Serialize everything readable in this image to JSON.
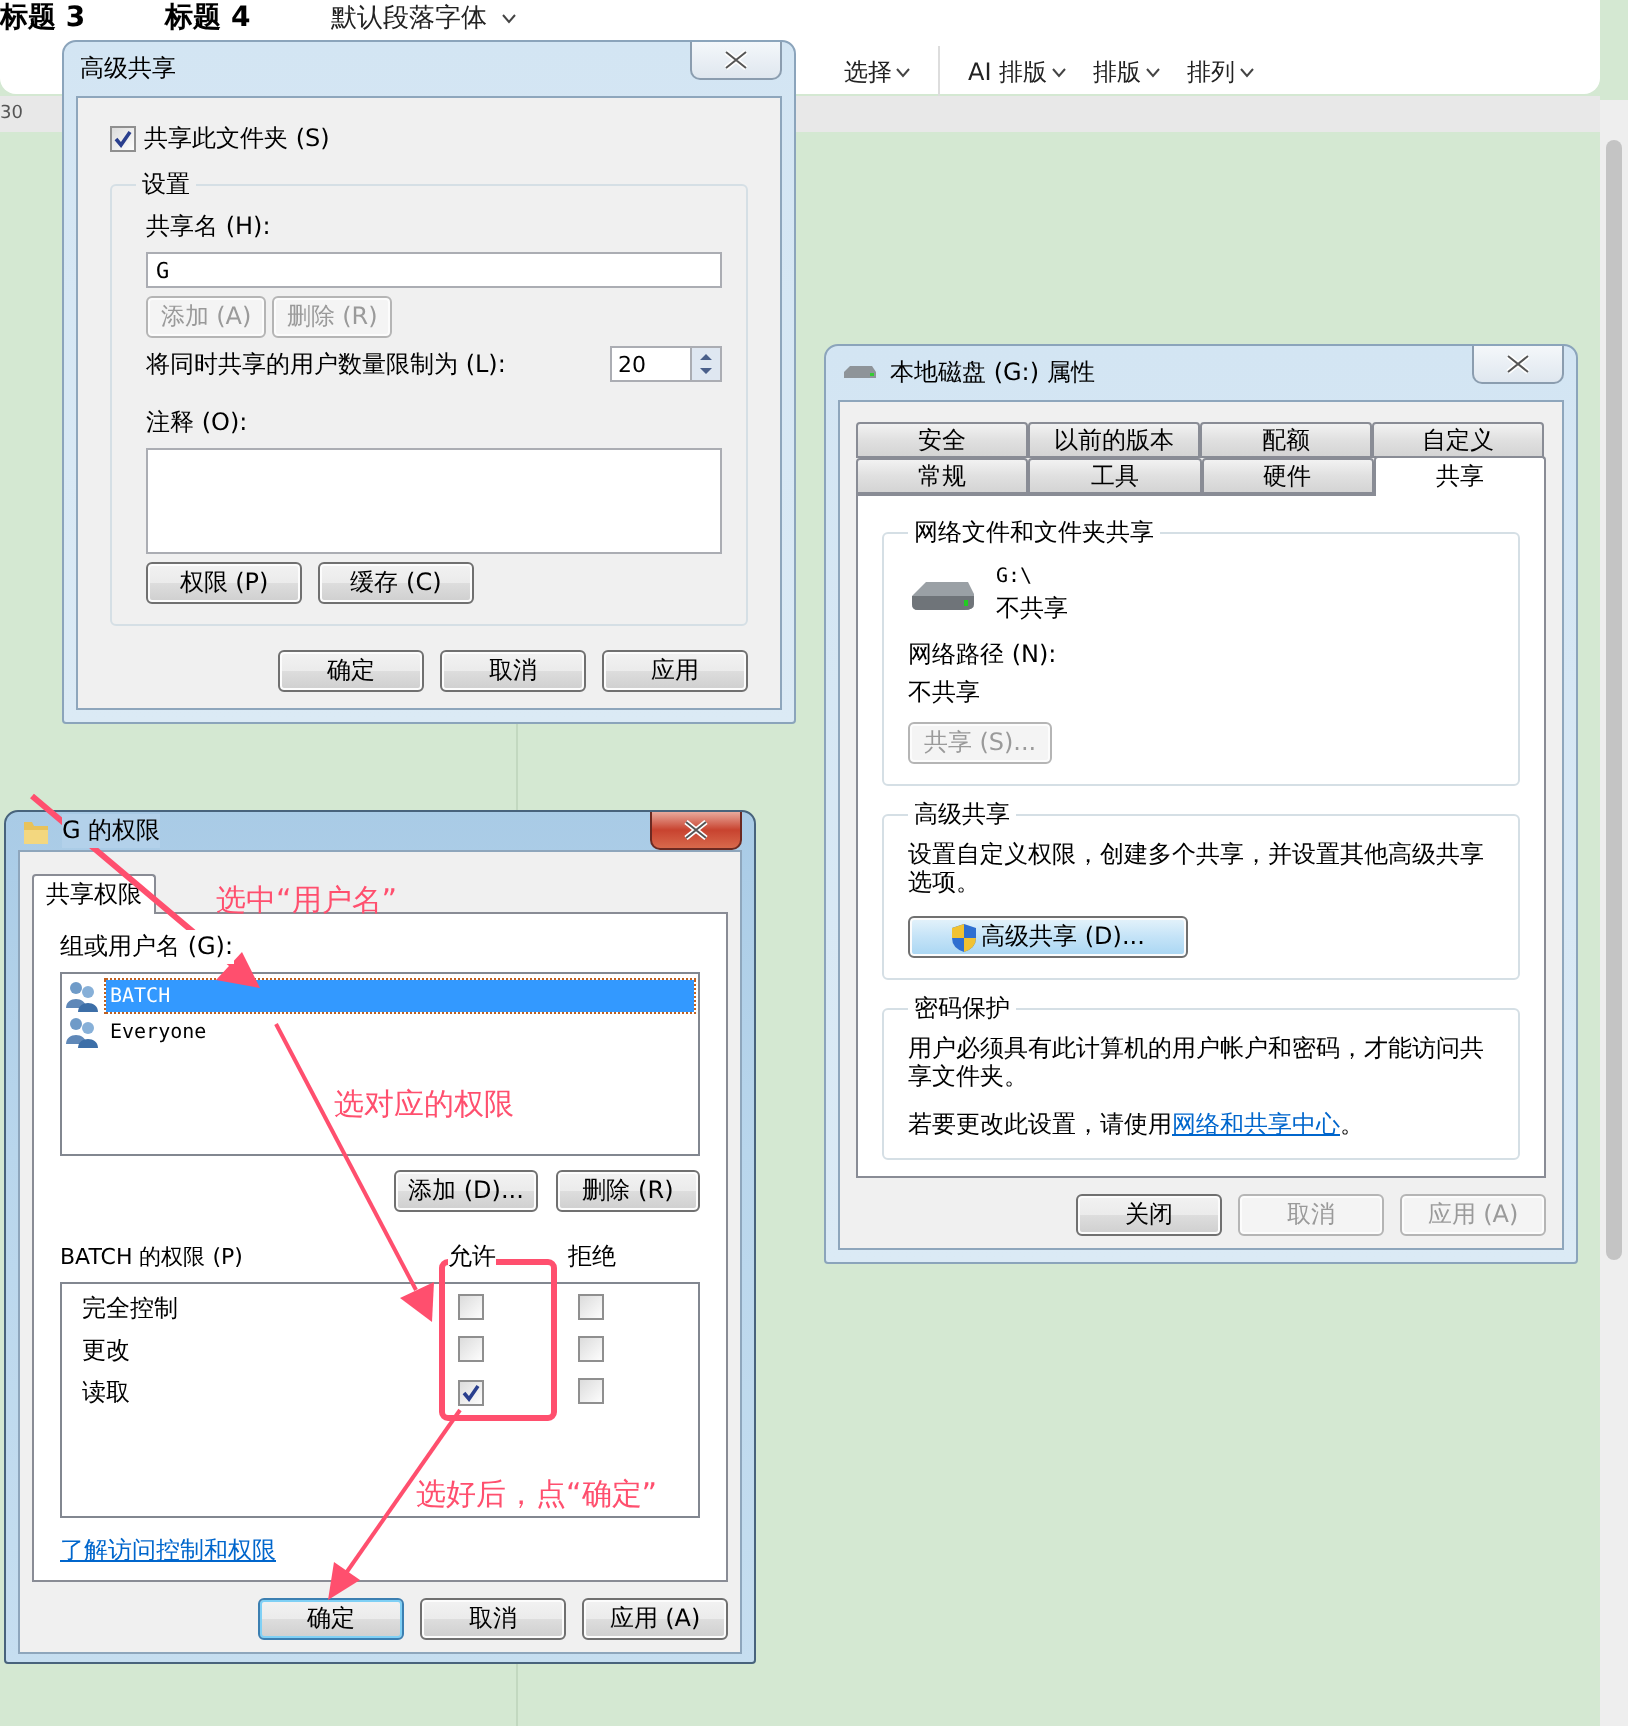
{
  "ribbon": {
    "styles": [
      "标题 3",
      "标题 4"
    ],
    "font_dropdown": "默认段落字体",
    "menus": [
      "选择",
      "AI 排版",
      "排版",
      "排列"
    ],
    "ruler_number": "30"
  },
  "advanced_sharing": {
    "title": "高级共享",
    "active": false,
    "share_checkbox": {
      "label": "共享此文件夹 (S)",
      "checked": true
    },
    "group_title": "设置",
    "share_name_label": "共享名 (H):",
    "share_name_value": "G",
    "name_buttons": [
      {
        "label": "添加 (A)",
        "disabled": true
      },
      {
        "label": "删除 (R)",
        "disabled": true
      }
    ],
    "limit_label": "将同时共享的用户数量限制为 (L):",
    "limit_value": "20",
    "comment_label": "注释 (O):",
    "group_buttons": [
      {
        "label": "权限 (P)",
        "disabled": false
      },
      {
        "label": "缓存 (C)",
        "disabled": false
      }
    ],
    "footer_buttons": [
      {
        "label": "确定",
        "disabled": false
      },
      {
        "label": "取消",
        "disabled": false
      },
      {
        "label": "应用",
        "disabled": false
      }
    ]
  },
  "properties": {
    "title": "本地磁盘 (G:) 属性",
    "active": false,
    "tab_rows": [
      [
        {
          "label": "安全",
          "selected": false
        },
        {
          "label": "以前的版本",
          "selected": false
        },
        {
          "label": "配额",
          "selected": false
        },
        {
          "label": "自定义",
          "selected": false
        }
      ],
      [
        {
          "label": "常规",
          "selected": false
        },
        {
          "label": "工具",
          "selected": false
        },
        {
          "label": "硬件",
          "selected": false
        },
        {
          "label": "共享",
          "selected": true
        }
      ]
    ],
    "network_group": {
      "title": "网络文件和文件夹共享",
      "path": "G:\\",
      "status": "不共享",
      "path_label": "网络路径 (N):",
      "path_value": "不共享",
      "button": {
        "label": "共享 (S)...",
        "disabled": true
      }
    },
    "advanced_group": {
      "title": "高级共享",
      "description": "设置自定义权限，创建多个共享，并设置其他高级共享选项。",
      "button": {
        "label": "高级共享 (D)...",
        "disabled": false
      }
    },
    "password_group": {
      "title": "密码保护",
      "description": "用户必须具有此计算机的用户帐户和密码，才能访问共享文件夹。",
      "hint_before": "若要更改此设置，请使用",
      "hint_link": "网络和共享中心",
      "hint_after": "。"
    },
    "footer_buttons": [
      {
        "label": "关闭",
        "disabled": false
      },
      {
        "label": "取消",
        "disabled": true
      },
      {
        "label": "应用 (A)",
        "disabled": true
      }
    ]
  },
  "permissions": {
    "title": "G 的权限",
    "active": true,
    "tab": {
      "label": "共享权限",
      "selected": true
    },
    "users_label": "组或用户名 (G):",
    "users": [
      {
        "name": "BATCH",
        "selected": true
      },
      {
        "name": "Everyone",
        "selected": false
      }
    ],
    "user_buttons": [
      {
        "label": "添加 (D)...",
        "disabled": false
      },
      {
        "label": "删除 (R)",
        "disabled": false
      }
    ],
    "perm_label": "BATCH 的权限 (P)",
    "columns": [
      "允许",
      "拒绝"
    ],
    "rows": [
      {
        "name": "完全控制",
        "allow": false,
        "deny": false
      },
      {
        "name": "更改",
        "allow": false,
        "deny": false
      },
      {
        "name": "读取",
        "allow": true,
        "deny": false
      }
    ],
    "link": "了解访问控制和权限",
    "footer_buttons": [
      {
        "label": "确定",
        "disabled": false,
        "default": true
      },
      {
        "label": "取消",
        "disabled": false,
        "default": false
      },
      {
        "label": "应用 (A)",
        "disabled": false,
        "default": false
      }
    ]
  },
  "annotations": [
    {
      "text": "选中“用户名”"
    },
    {
      "text": "选对应的权限"
    },
    {
      "text": "选好后，点“确定”"
    }
  ]
}
